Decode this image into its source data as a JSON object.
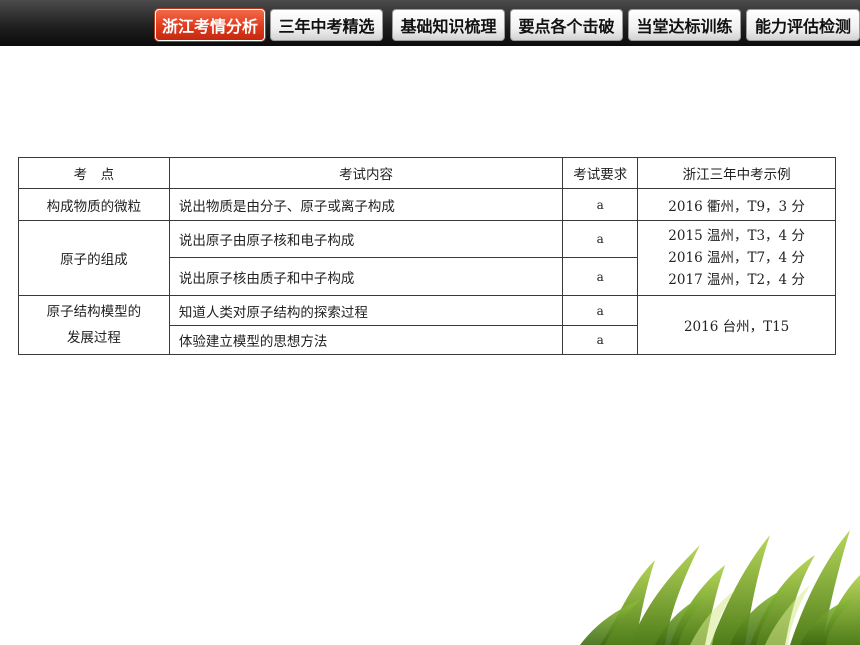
{
  "nav": {
    "tabs": [
      {
        "label": "浙江考情分析",
        "active": true
      },
      {
        "label": "三年中考精选",
        "active": false
      },
      {
        "label": "基础知识梳理",
        "active": false
      },
      {
        "label": "要点各个击破",
        "active": false
      },
      {
        "label": "当堂达标训练",
        "active": false
      },
      {
        "label": "能力评估检测",
        "active": false
      }
    ]
  },
  "table": {
    "headers": [
      "考　点",
      "考试内容",
      "考试要求",
      "浙江三年中考示例"
    ],
    "groups": [
      {
        "point_lines": [
          "构成物质的微粒"
        ],
        "rows": [
          {
            "content": "说出物质是由分子、原子或离子构成",
            "req": "a"
          }
        ],
        "examples": [
          "2016 衢州，T9，3 分"
        ]
      },
      {
        "point_lines": [
          "原子的组成"
        ],
        "rows": [
          {
            "content": "说出原子由原子核和电子构成",
            "req": "a"
          },
          {
            "content": "说出原子核由质子和中子构成",
            "req": "a"
          }
        ],
        "examples": [
          "2015 温州，T3，4 分",
          "2016 温州，T7，4 分",
          "2017 温州，T2，4 分"
        ]
      },
      {
        "point_lines": [
          "原子结构模型的",
          "发展过程"
        ],
        "rows": [
          {
            "content": "知道人类对原子结构的探索过程",
            "req": "a"
          },
          {
            "content": "体验建立模型的思想方法",
            "req": "a"
          }
        ],
        "examples": [
          "2016 台州，T15"
        ]
      }
    ]
  },
  "colors": {
    "active_tab": "#e03a1c",
    "bar": "#1e1e1e",
    "grass": "#7fae2c"
  },
  "icons": {
    "decoration": "grass-leaves-icon"
  }
}
